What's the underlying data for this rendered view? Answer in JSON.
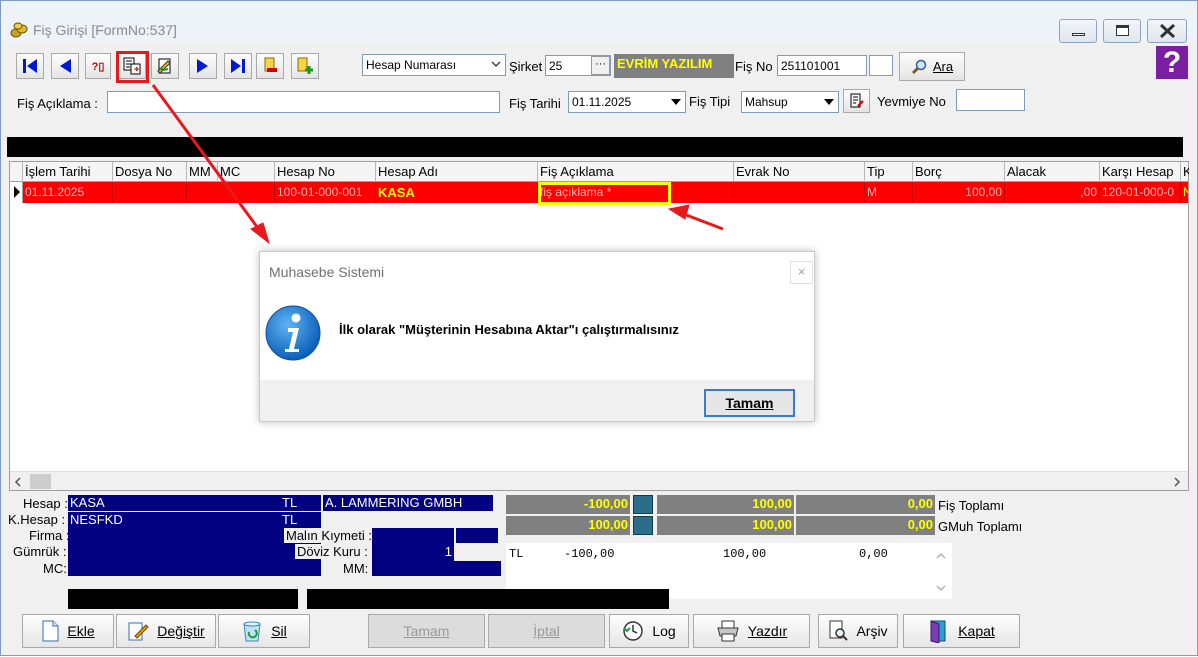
{
  "window": {
    "title": "Fiş Girişi [FormNo:537]"
  },
  "toolbar": {
    "account_combo": "Hesap Numarası",
    "sirket_label": "Şirket",
    "sirket_value": "25",
    "sirket_btn": "···",
    "company_name": "EVRİM YAZILIM",
    "fis_no_label": "Fiş No",
    "fis_no_value": "251101001",
    "ara_label": "Ara",
    "help_glyph": "?"
  },
  "header": {
    "fis_aciklama_label": "Fiş Açıklama :",
    "fis_aciklama_value": "",
    "fis_tarihi_label": "Fiş Tarihi",
    "fis_tarihi_value": "01.11.2025",
    "fis_tipi_label": "Fiş  Tipi",
    "fis_tipi_value": "Mahsup",
    "yevmiye_label": "Yevmiye No",
    "yevmiye_value": ""
  },
  "grid": {
    "columns": [
      "İşlem Tarihi",
      "Dosya No",
      "MM",
      "MC",
      "Hesap No",
      "Hesap Adı",
      "Fiş Açıklama",
      "Evrak No",
      "Tip",
      "Borç",
      "Alacak",
      "Karşı Hesap",
      "K"
    ],
    "rows": [
      [
        "01.11.2025",
        "",
        "",
        "",
        "100-01-000-001",
        "KASA",
        "fiş açıklama *",
        "",
        "M",
        "100,00",
        ",00",
        "120-01-000-0",
        "N"
      ]
    ]
  },
  "dialog": {
    "title": "Muhasebe Sistemi",
    "message": "İlk olarak \"Müşterinin Hesabına Aktar\"ı çalıştırmalısınız",
    "ok_label": "Tamam",
    "close_glyph": "×"
  },
  "summary": {
    "hesap_label": "Hesap :",
    "hesap_value": "KASA",
    "khesap_label": "K.Hesap :",
    "khesap_value": "NESFKD",
    "firma_label": "Firma :",
    "gumruk_label": "Gümrük :",
    "mc_label": "MC:",
    "currency1": "TL",
    "currency2": "TL",
    "firm_name": "A. LAMMERING GMBH",
    "malin_kiymeti_label": "Malın Kıymeti :",
    "doviz_kuru_label": "Döviz Kuru :",
    "doviz_kuru_value": "1",
    "mm_label": "MM:",
    "fis_toplami_label": "Fiş Toplamı",
    "gmuh_toplami_label": "GMuh Toplamı",
    "fis_toplami": [
      "-100,00",
      "100,00",
      "0,00"
    ],
    "gmuh_toplami": [
      "100,00",
      "100,00",
      "0,00"
    ],
    "memo_line": {
      "cur": "TL",
      "v1": "-100,00",
      "v2": "100,00",
      "v3": "0,00"
    }
  },
  "buttons": {
    "ekle": "Ekle",
    "degistir": "Değiştir",
    "sil": "Sil",
    "tamam": "Tamam",
    "iptal": "İptal",
    "log": "Log",
    "yazdir": "Yazdır",
    "arsiv": "Arşiv",
    "kapat": "Kapat"
  },
  "colors": {
    "row_highlight": "#ff0000",
    "annotation": "#e8191c",
    "callout_box": "#ffff00",
    "navy_field": "#000080"
  }
}
